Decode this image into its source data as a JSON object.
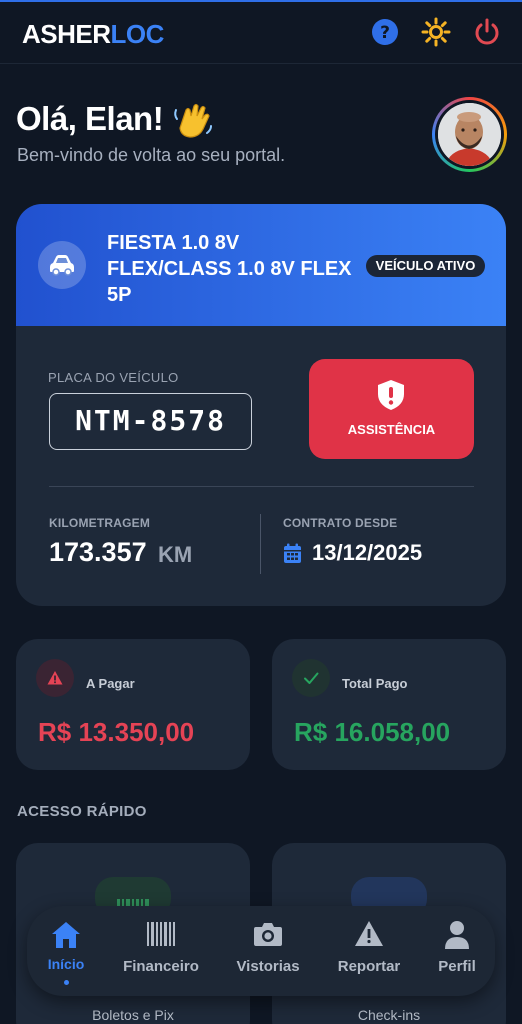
{
  "brand": {
    "part1": "ASHER",
    "part2": "LOC"
  },
  "header_icons": [
    "help-icon",
    "sun-icon",
    "power-icon"
  ],
  "greeting": {
    "title": "Olá, Elan!",
    "subtitle": "Bem-vindo de volta ao seu portal."
  },
  "vehicle": {
    "model": "FIESTA 1.0 8V FLEX/CLASS 1.0 8V FLEX 5P",
    "status_badge": "VEÍCULO ATIVO",
    "plate_label": "PLACA DO VEÍCULO",
    "plate": "NTM-8578",
    "assist_label": "ASSISTÊNCIA",
    "km_label": "KILOMETRAGEM",
    "km_value": "173.357",
    "km_unit": "KM",
    "since_label": "CONTRATO DESDE",
    "since_value": "13/12/2025"
  },
  "stats": {
    "to_pay_label": "A Pagar",
    "to_pay_value": "R$ 13.350,00",
    "paid_label": "Total Pago",
    "paid_value": "R$ 16.058,00"
  },
  "quick_access": {
    "title": "ACESSO RÁPIDO",
    "items": [
      {
        "label": "Boletos e Pix"
      },
      {
        "label": "Check-ins"
      }
    ]
  },
  "nav": {
    "items": [
      {
        "label": "Início",
        "icon": "home-icon"
      },
      {
        "label": "Financeiro",
        "icon": "barcode-icon"
      },
      {
        "label": "Vistorias",
        "icon": "camera-icon"
      },
      {
        "label": "Reportar",
        "icon": "warning-icon"
      },
      {
        "label": "Perfil",
        "icon": "user-icon"
      }
    ]
  },
  "colors": {
    "background": "#0f1724",
    "card": "#1e2939",
    "accent": "#3b82f6",
    "danger": "#e03347",
    "success": "#27a55f"
  }
}
